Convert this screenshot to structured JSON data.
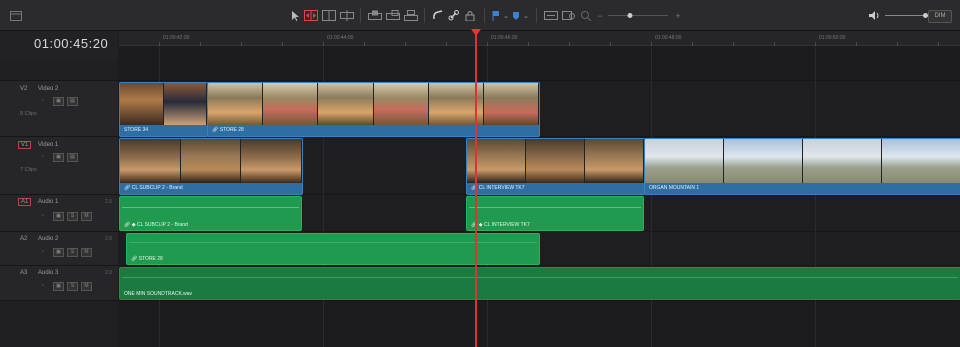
{
  "toolbar": {
    "icons": [
      "panel-toggle-icon",
      "selection-pointer-icon",
      "trim-edit-icon",
      "dynamic-trim-icon",
      "blade-icon",
      "overwrite-clip-icon",
      "replace-clip-icon",
      "place-on-top-icon",
      "snapping-icon",
      "linked-selection-icon",
      "position-lock-icon",
      "flag-icon",
      "marker-icon",
      "zoom-full-icon",
      "zoom-detail-icon",
      "zoom-custom-icon",
      "zoom-out-icon",
      "zoom-in-icon",
      "speaker-icon"
    ],
    "dim_label": "DIM"
  },
  "timecode": "01:00:45:20",
  "ruler_labels": [
    "01:00:42:00",
    "01:00:44:00",
    "01:00:46:00",
    "01:00:48:00",
    "01:00:50:00"
  ],
  "tracks": [
    {
      "id": "V2",
      "name": "Video 2",
      "sub": "8 Clips",
      "type": "video"
    },
    {
      "id": "V1",
      "name": "Video 1",
      "sub": "7 Clips",
      "type": "video"
    },
    {
      "id": "A1",
      "name": "Audio 1",
      "level": "2.0",
      "type": "audio"
    },
    {
      "id": "A2",
      "name": "Audio 2",
      "level": "2.0",
      "type": "audio"
    },
    {
      "id": "A3",
      "name": "Audio 3",
      "level": "2.0",
      "type": "audio"
    }
  ],
  "audio_buttons": {
    "s": "S",
    "m": "M"
  },
  "clips": {
    "v2_store34": "STORE 34",
    "v2_store28": "STORE 28",
    "v1_subclip": "CL SUBCLIP 2 - Brand",
    "v1_interview": "CL INTERVIEW TK7",
    "v1_mountain": "ORGAN MOUNTAIN 1",
    "a1_subclip": "CL SUBCLIP 2 - Brand",
    "a1_interview": "CL INTERVIEW TK7",
    "a2_store28": "STORE 28",
    "a3_soundtrack": "ONE MIN SOUNDTRACK.wav"
  },
  "colors": {
    "video_clip": "#2f6ea3",
    "audio_clip": "#1f9a4f",
    "playhead": "#dd3333",
    "track_header_active": "#b44444"
  }
}
